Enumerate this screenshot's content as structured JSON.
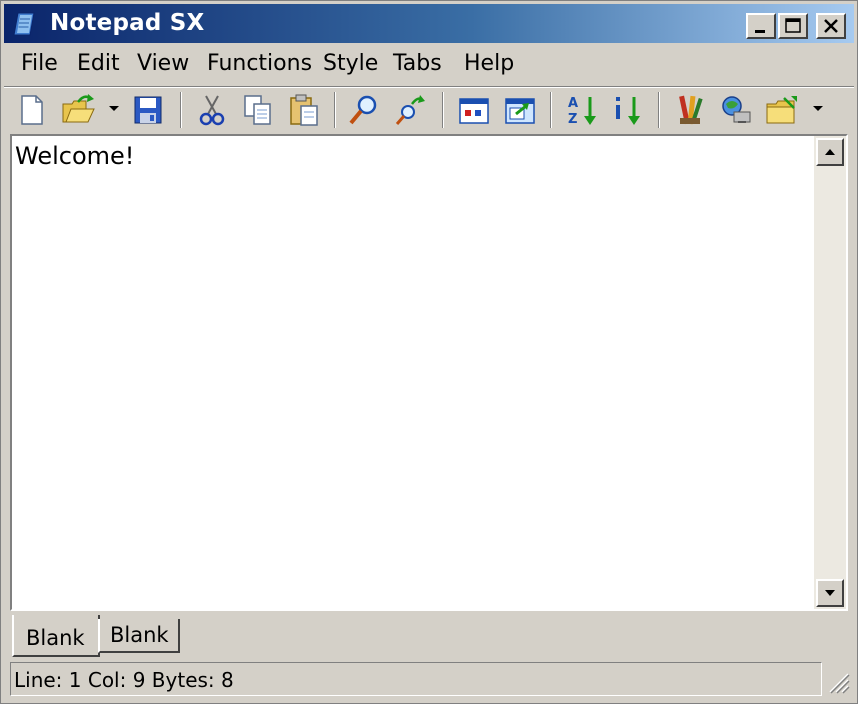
{
  "window": {
    "title": "Notepad SX"
  },
  "caption_buttons": {
    "minimize": "minimize",
    "maximize": "maximize",
    "close": "close"
  },
  "menu": [
    "File",
    "Edit",
    "View",
    "Functions",
    "Style",
    "Tabs",
    "Help"
  ],
  "toolbar_icons": [
    "new-file-icon",
    "open-folder-icon",
    "save-icon",
    "cut-icon",
    "copy-icon",
    "paste-icon",
    "find-icon",
    "replace-icon",
    "window-icon",
    "new-window-icon",
    "sort-ascending-icon",
    "sort-descending-icon",
    "settings-icon",
    "run-icon",
    "folder-tools-icon"
  ],
  "editor": {
    "content": "Welcome!"
  },
  "tabs": [
    {
      "label": "Blank",
      "active": true
    },
    {
      "label": "Blank",
      "active": false
    }
  ],
  "status": {
    "text": "Line: 1  Col: 9  Bytes: 8"
  },
  "colors": {
    "title_start": "#0a246a",
    "title_end": "#a6caf0",
    "chrome": "#d4d0c8"
  }
}
